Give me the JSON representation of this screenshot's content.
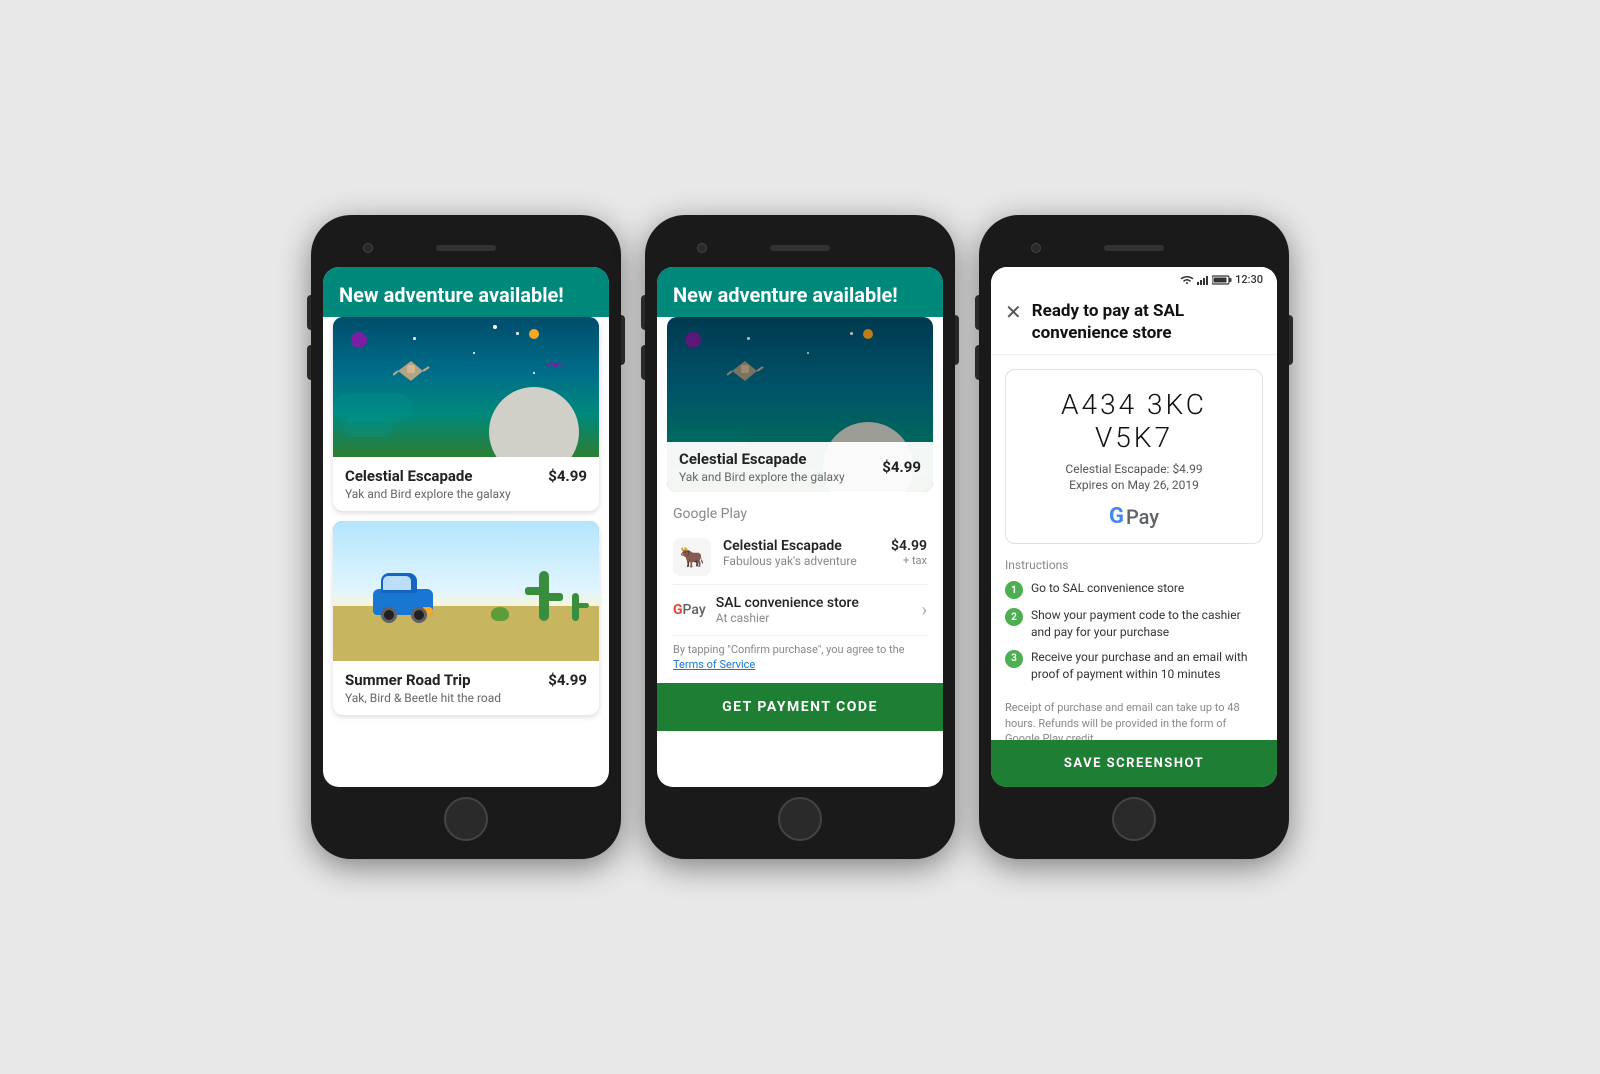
{
  "phone1": {
    "header": "New adventure available!",
    "card1": {
      "title": "Celestial Escapade",
      "subtitle": "Yak and Bird explore the galaxy",
      "price": "$4.99"
    },
    "card2": {
      "title": "Summer Road Trip",
      "subtitle": "Yak, Bird & Beetle hit the road",
      "price": "$4.99"
    }
  },
  "phone2": {
    "header": "New adventure available!",
    "card": {
      "title": "Celestial Escapade",
      "subtitle": "Yak and Bird explore the galaxy",
      "price": "$4.99"
    },
    "sheet": {
      "title": "Google Play",
      "item_name": "Celestial Escapade",
      "item_sub": "Fabulous yak's adventure",
      "item_price": "$4.99",
      "item_tax": "+ tax",
      "store_name": "SAL convenience store",
      "store_sub": "At cashier",
      "tos_text": "By tapping \"Confirm purchase\", you agree to the",
      "tos_link": "Terms of Service",
      "button": "GET  PAYMENT CODE"
    }
  },
  "phone3": {
    "status_time": "12:30",
    "header_title": "Ready to pay at SAL convenience store",
    "code": "A434 3KC V5K7",
    "code_desc": "Celestial Escapade: $4.99",
    "code_expire": "Expires on May 26, 2019",
    "instructions_title": "Instructions",
    "instructions": [
      "Go to SAL convenience store",
      "Show your payment code to the cashier and pay for your purchase",
      "Receive your purchase and an email with proof of payment within 10 minutes"
    ],
    "disclaimer": "Receipt of purchase and email can take up to 48 hours. Refunds will be provided in the form of Google Play credit.",
    "save_button": "SAVE SCREENSHOT"
  }
}
